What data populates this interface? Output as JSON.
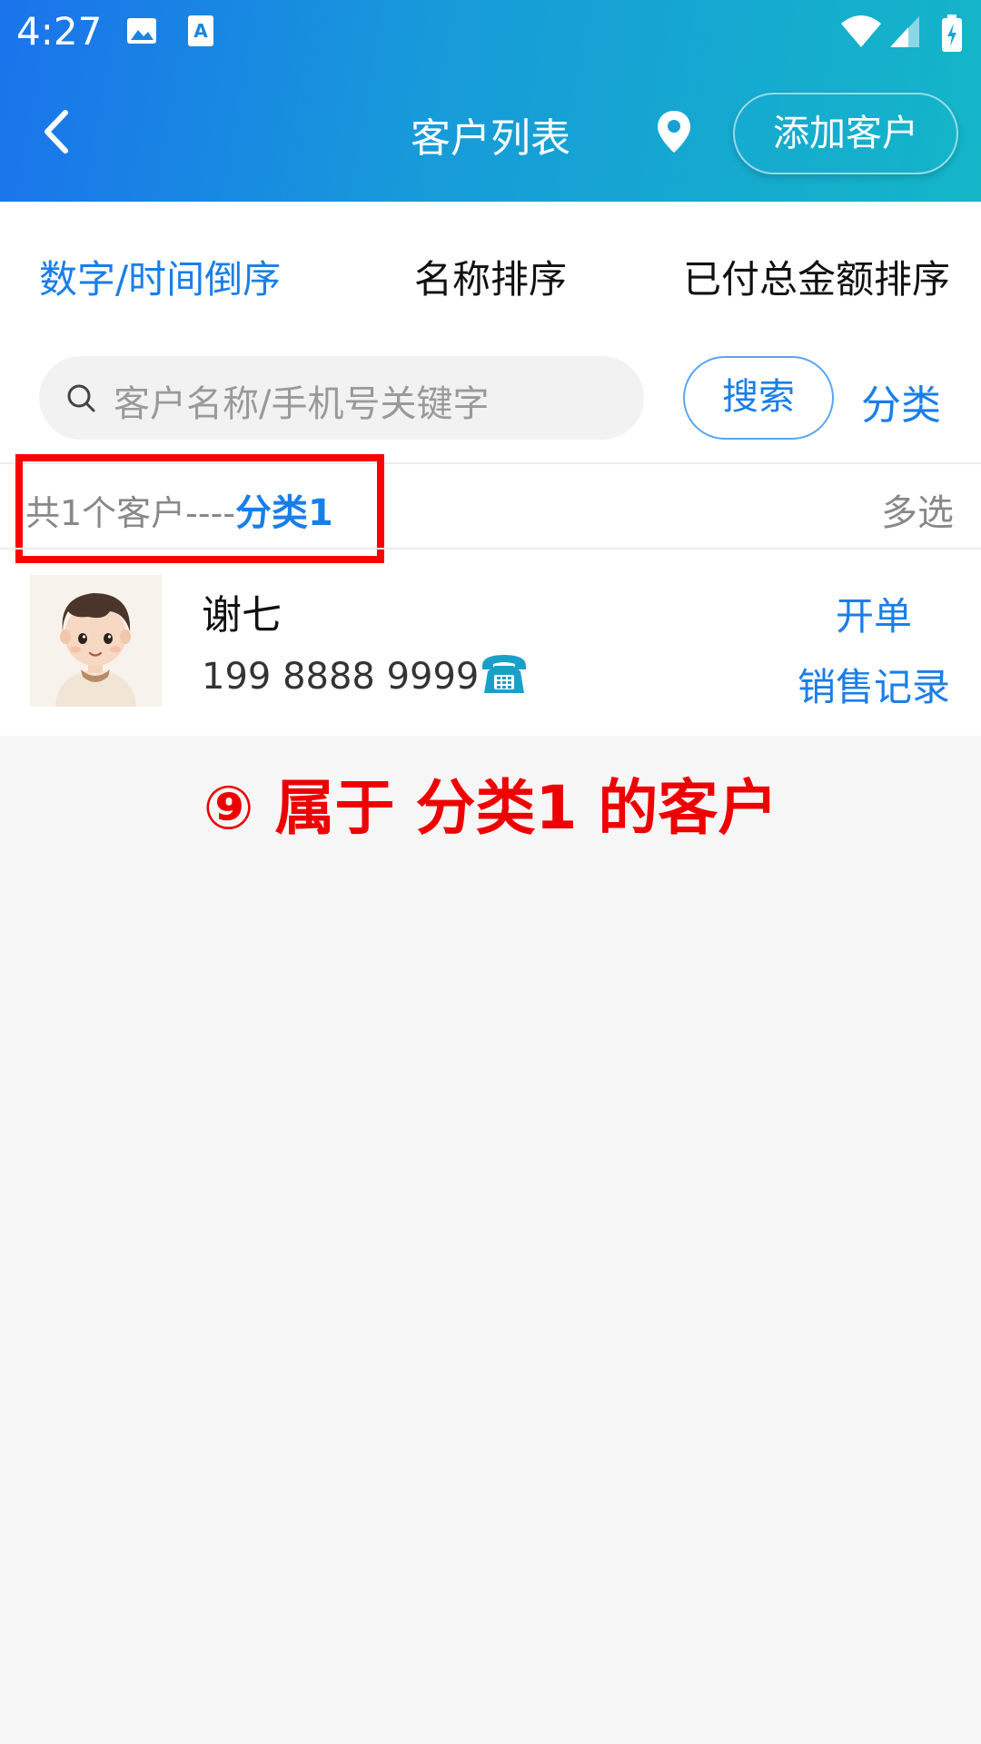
{
  "status_bar": {
    "time": "4:27",
    "icons": [
      "image-icon",
      "keyboard-a-icon",
      "wifi-icon",
      "signal-icon",
      "battery-charging-icon"
    ]
  },
  "header": {
    "title": "客户列表",
    "back_icon": "chevron-left-icon",
    "location_icon": "location-pin-icon",
    "add_button_label": "添加客户"
  },
  "sort_tabs": [
    {
      "label": "数字/时间倒序",
      "active": true
    },
    {
      "label": "名称排序",
      "active": false
    },
    {
      "label": "已付总金额排序",
      "active": false
    }
  ],
  "search": {
    "placeholder": "客户名称/手机号关键字",
    "button_label": "搜索",
    "category_label": "分类"
  },
  "summary": {
    "count_text": "共1个客户----",
    "category_text": "分类1",
    "multi_select_label": "多选"
  },
  "customers": [
    {
      "name": "谢七",
      "phone": "199 8888 9999",
      "action_primary": "开单",
      "action_secondary": "销售记录"
    }
  ],
  "annotation": "⑨ 属于 分类1 的客户",
  "colors": {
    "accent": "#1a7ee8",
    "header_gradient_start": "#1a73ec",
    "header_gradient_end": "#14b6c8",
    "highlight": "#ff0000"
  }
}
